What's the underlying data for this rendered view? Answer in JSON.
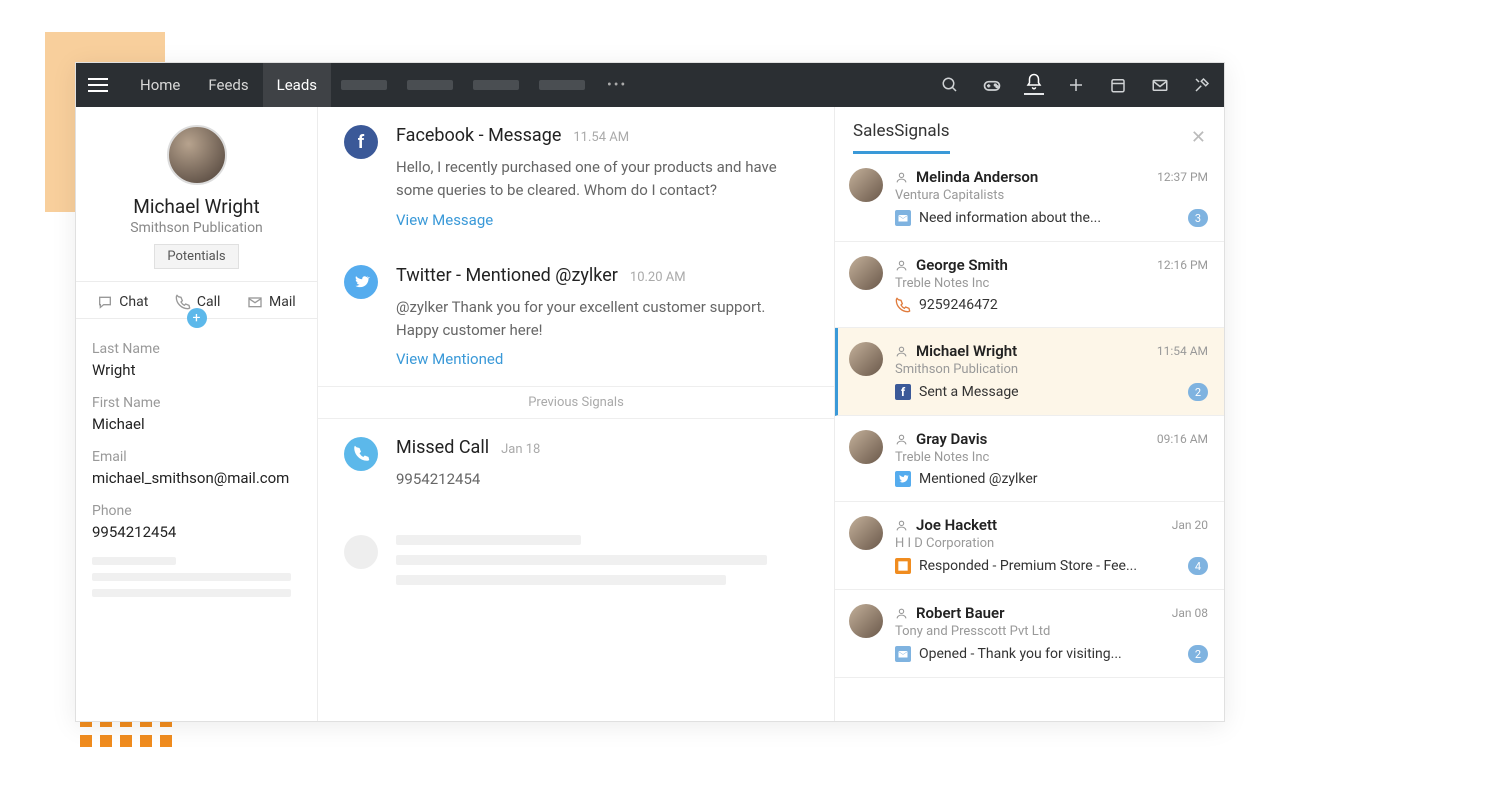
{
  "nav": {
    "items": [
      "Home",
      "Feeds",
      "Leads"
    ],
    "active": 2
  },
  "lead": {
    "name": "Michael Wright",
    "company": "Smithson Publication",
    "potentials_label": "Potentials",
    "actions": {
      "chat": "Chat",
      "call": "Call",
      "mail": "Mail"
    },
    "fields": [
      {
        "label": "Last Name",
        "value": "Wright"
      },
      {
        "label": "First Name",
        "value": "Michael"
      },
      {
        "label": "Email",
        "value": "michael_smithson@mail.com"
      },
      {
        "label": "Phone",
        "value": "9954212454"
      }
    ]
  },
  "feed": {
    "items": [
      {
        "source": "fb",
        "title": "Facebook - Message",
        "time": "11.54 AM",
        "body": "Hello,\nI recently purchased one of your products and have some queries to be cleared. Whom do I contact?",
        "link": "View Message"
      },
      {
        "source": "tw",
        "title": "Twitter - Mentioned @zylker",
        "time": "10.20 AM",
        "body": "@zylker Thank you for your excellent customer support. Happy customer here!",
        "link": "View Mentioned"
      }
    ],
    "divider": "Previous Signals",
    "previous": [
      {
        "source": "call",
        "title": "Missed Call",
        "time": "Jan 18",
        "body": "9954212454"
      }
    ]
  },
  "signals": {
    "title": "SalesSignals",
    "items": [
      {
        "name": "Melinda Anderson",
        "company": "Ventura Capitalists",
        "time": "12:37 PM",
        "icon": "mail",
        "action": "Need information about the...",
        "badge": "3"
      },
      {
        "name": "George Smith",
        "company": "Treble Notes Inc",
        "time": "12:16 PM",
        "icon": "phone",
        "action": "9259246472",
        "badge": ""
      },
      {
        "name": "Michael Wright",
        "company": "Smithson Publication",
        "time": "11:54 AM",
        "icon": "fb",
        "action": "Sent a Message",
        "badge": "2",
        "selected": true
      },
      {
        "name": "Gray Davis",
        "company": "Treble Notes Inc",
        "time": "09:16 AM",
        "icon": "tw",
        "action": "Mentioned @zylker",
        "badge": ""
      },
      {
        "name": "Joe Hackett",
        "company": "H I D Corporation",
        "time": "Jan 20",
        "icon": "survey",
        "action": "Responded - Premium Store - Fee...",
        "badge": "4"
      },
      {
        "name": "Robert Bauer",
        "company": "Tony and Presscott Pvt Ltd",
        "time": "Jan 08",
        "icon": "mail",
        "action": "Opened - Thank you for visiting...",
        "badge": "2"
      }
    ]
  }
}
